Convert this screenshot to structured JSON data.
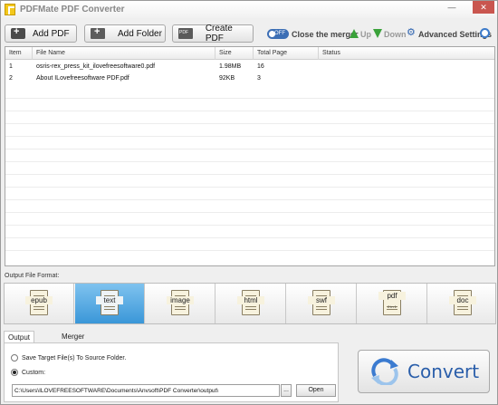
{
  "window": {
    "title": "PDFMate PDF Converter"
  },
  "titlebar": {
    "minimize": "—",
    "close": "✕"
  },
  "toolbar": {
    "add_pdf": "Add PDF",
    "add_folder": "Add Folder",
    "create_pdf": "Create PDF",
    "toggle_state": "OFF",
    "close_merger": "Close the merger",
    "up": "Up",
    "down": "Down",
    "advanced": "Advanced Settings"
  },
  "table": {
    "columns": [
      "Item",
      "File Name",
      "Size",
      "Total Page",
      "Status"
    ],
    "rows": [
      {
        "item": "1",
        "name": "osris-rex_press_kit_ilovefreesoftware0.pdf",
        "size": "1.98MB",
        "pages": "16",
        "status": ""
      },
      {
        "item": "2",
        "name": "About ILovefreesoftware PDF.pdf",
        "size": "92KB",
        "pages": "3",
        "status": ""
      }
    ]
  },
  "output_format": {
    "label": "Output File Format:",
    "formats": [
      {
        "label": "epub",
        "selected": false
      },
      {
        "label": "text",
        "selected": true
      },
      {
        "label": "image",
        "selected": false
      },
      {
        "label": "html",
        "selected": false
      },
      {
        "label": "swf",
        "selected": false
      },
      {
        "label": "pdf",
        "sub": "2 in 1",
        "selected": false
      },
      {
        "label": "doc",
        "selected": false
      }
    ]
  },
  "tabs": {
    "output_folder": "Output Folder",
    "merger_setting": "Merger Setting"
  },
  "output": {
    "save_to_source": "Save Target File(s) To Source Folder.",
    "custom": "Custom:",
    "path": "C:\\Users\\ILOVEFREESOFTWARE\\Documents\\Anvsoft\\PDF Converter\\output\\",
    "browse": "...",
    "open": "Open"
  },
  "convert": {
    "label": "Convert"
  },
  "colors": {
    "selected_format": "#3a97d8",
    "toggle": "#3d6fb5",
    "arrow": "#3aa23a",
    "convert_text": "#2a5eaa"
  }
}
